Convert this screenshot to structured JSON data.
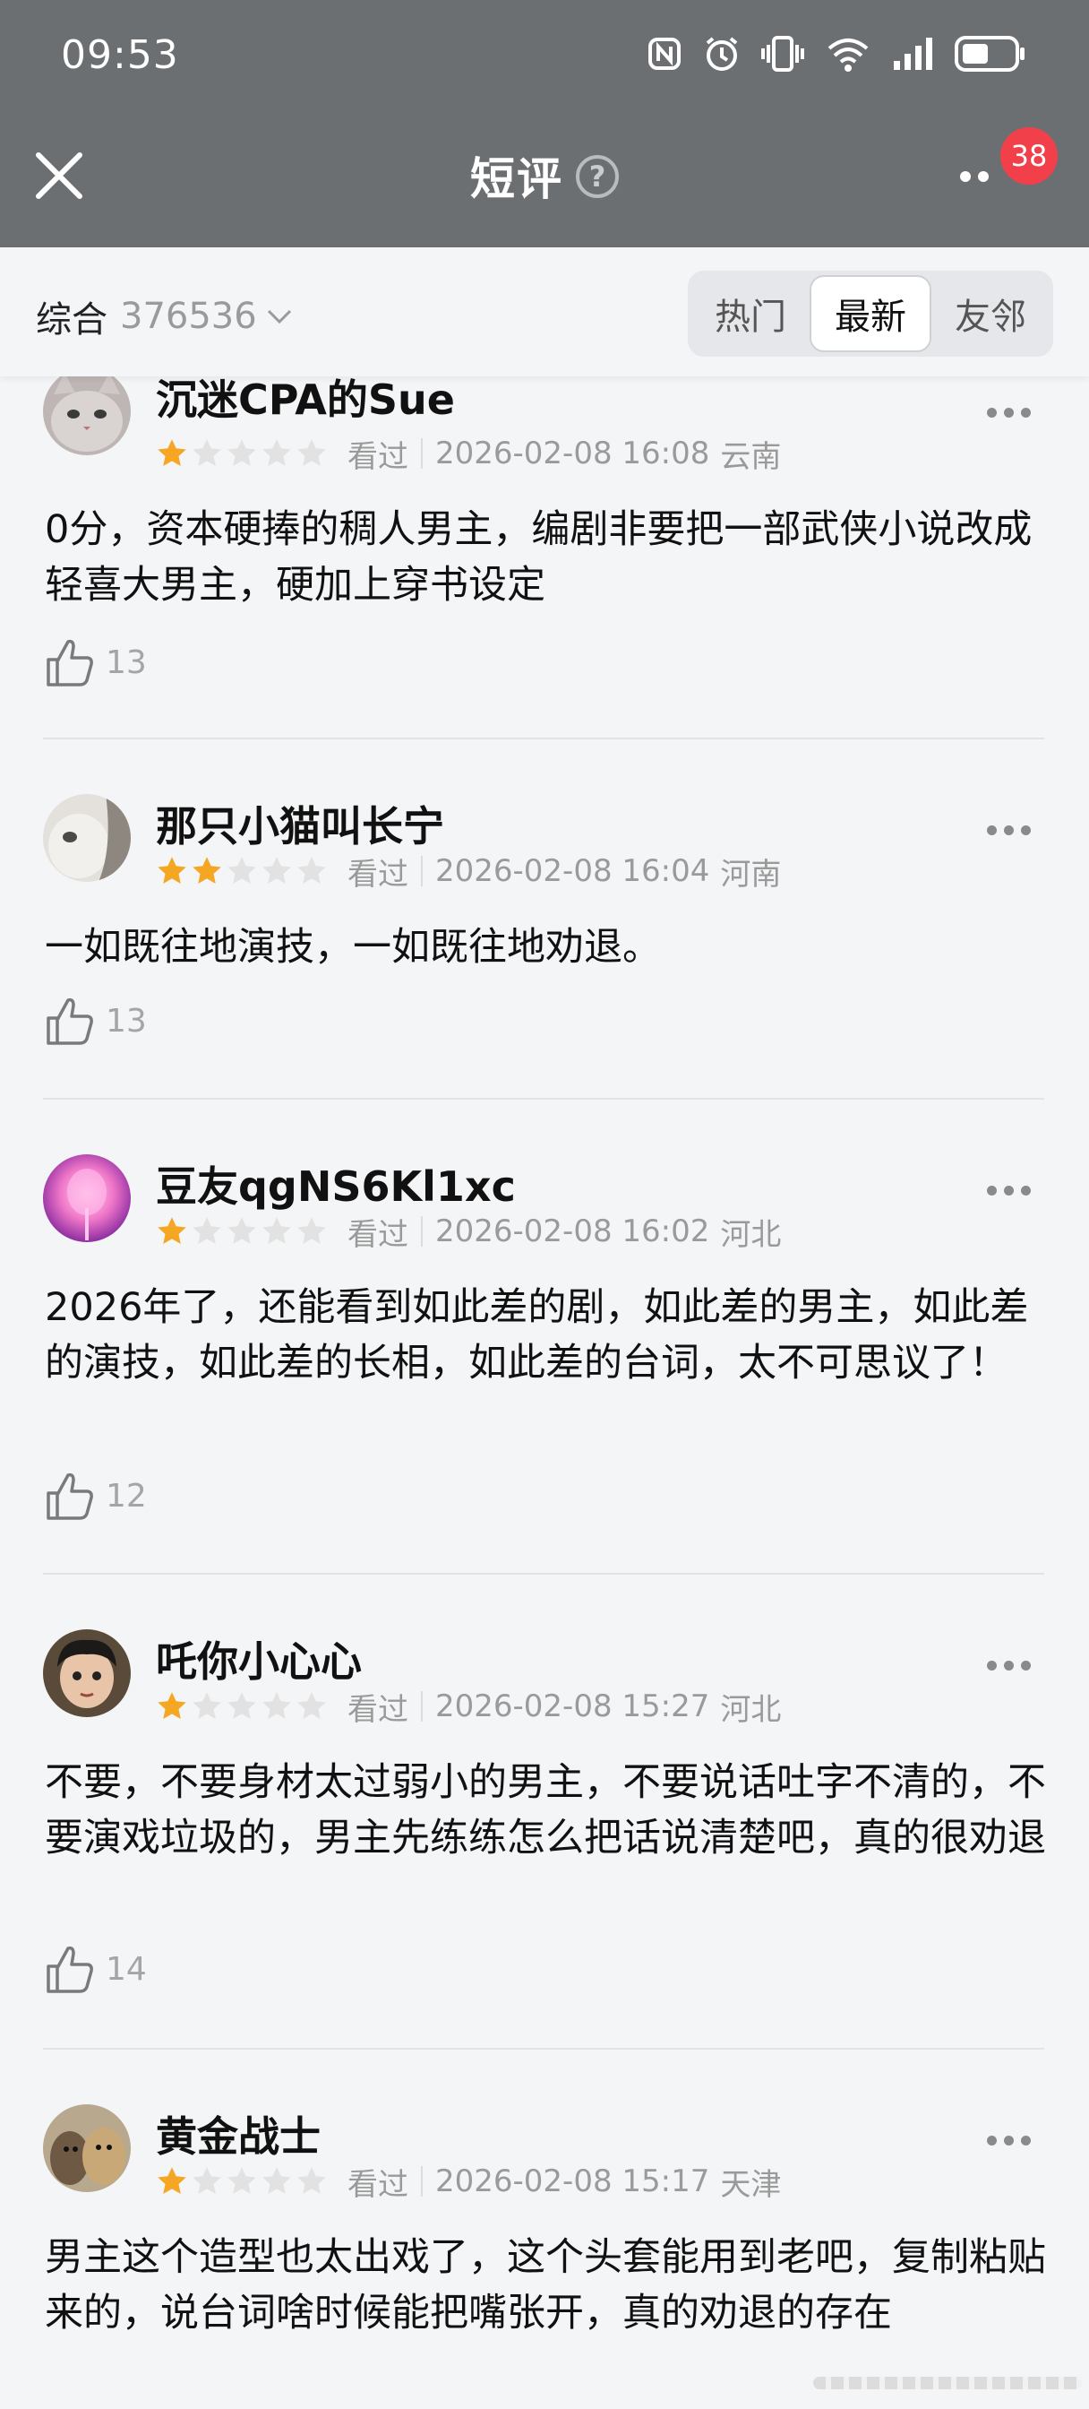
{
  "status_bar": {
    "time": "09:53",
    "icons": [
      "nfc-icon",
      "alarm-icon",
      "vibrate-icon",
      "wifi-icon",
      "signal-icon",
      "battery-icon"
    ]
  },
  "nav": {
    "title": "短评",
    "help": "?",
    "badge": "38",
    "accent": "#f2404b"
  },
  "filter": {
    "sort_label": "综合",
    "count": "376536",
    "tabs": [
      {
        "label": "热门",
        "active": false
      },
      {
        "label": "最新",
        "active": true
      },
      {
        "label": "友邻",
        "active": false
      }
    ]
  },
  "colors": {
    "topbar": "#6c6f72",
    "star_on": "#f5a623",
    "star_off": "#e2e2e2"
  },
  "reviews": [
    {
      "username": "沉迷CPA的Sue",
      "stars": 1,
      "status": "看过",
      "time": "2026-02-08 16:08",
      "location": "云南",
      "content": "0分，资本硬捧的稠人男主，编剧非要把一部武侠小说改成轻喜大男主，硬加上穿书设定",
      "likes": "13"
    },
    {
      "username": "那只小猫叫长宁",
      "stars": 2,
      "status": "看过",
      "time": "2026-02-08 16:04",
      "location": "河南",
      "content": "一如既往地演技，一如既往地劝退。",
      "likes": "13"
    },
    {
      "username": "豆友qgNS6Kl1xc",
      "stars": 1,
      "status": "看过",
      "time": "2026-02-08 16:02",
      "location": "河北",
      "content": "2026年了，还能看到如此差的剧，如此差的男主，如此差的演技，如此差的长相，如此差的台词，太不可思议了！",
      "likes": "12"
    },
    {
      "username": "吒你小心心",
      "stars": 1,
      "status": "看过",
      "time": "2026-02-08 15:27",
      "location": "河北",
      "content": "不要，不要身材太过弱小的男主，不要说话吐字不清的，不要演戏垃圾的，男主先练练怎么把话说清楚吧，真的很劝退",
      "likes": "14"
    },
    {
      "username": "黄金战士",
      "stars": 1,
      "status": "看过",
      "time": "2026-02-08 15:17",
      "location": "天津",
      "content": "男主这个造型也太出戏了，这个头套能用到老吧，复制粘贴来的，说台词啥时候能把嘴张开，真的劝退的存在",
      "likes": ""
    }
  ]
}
